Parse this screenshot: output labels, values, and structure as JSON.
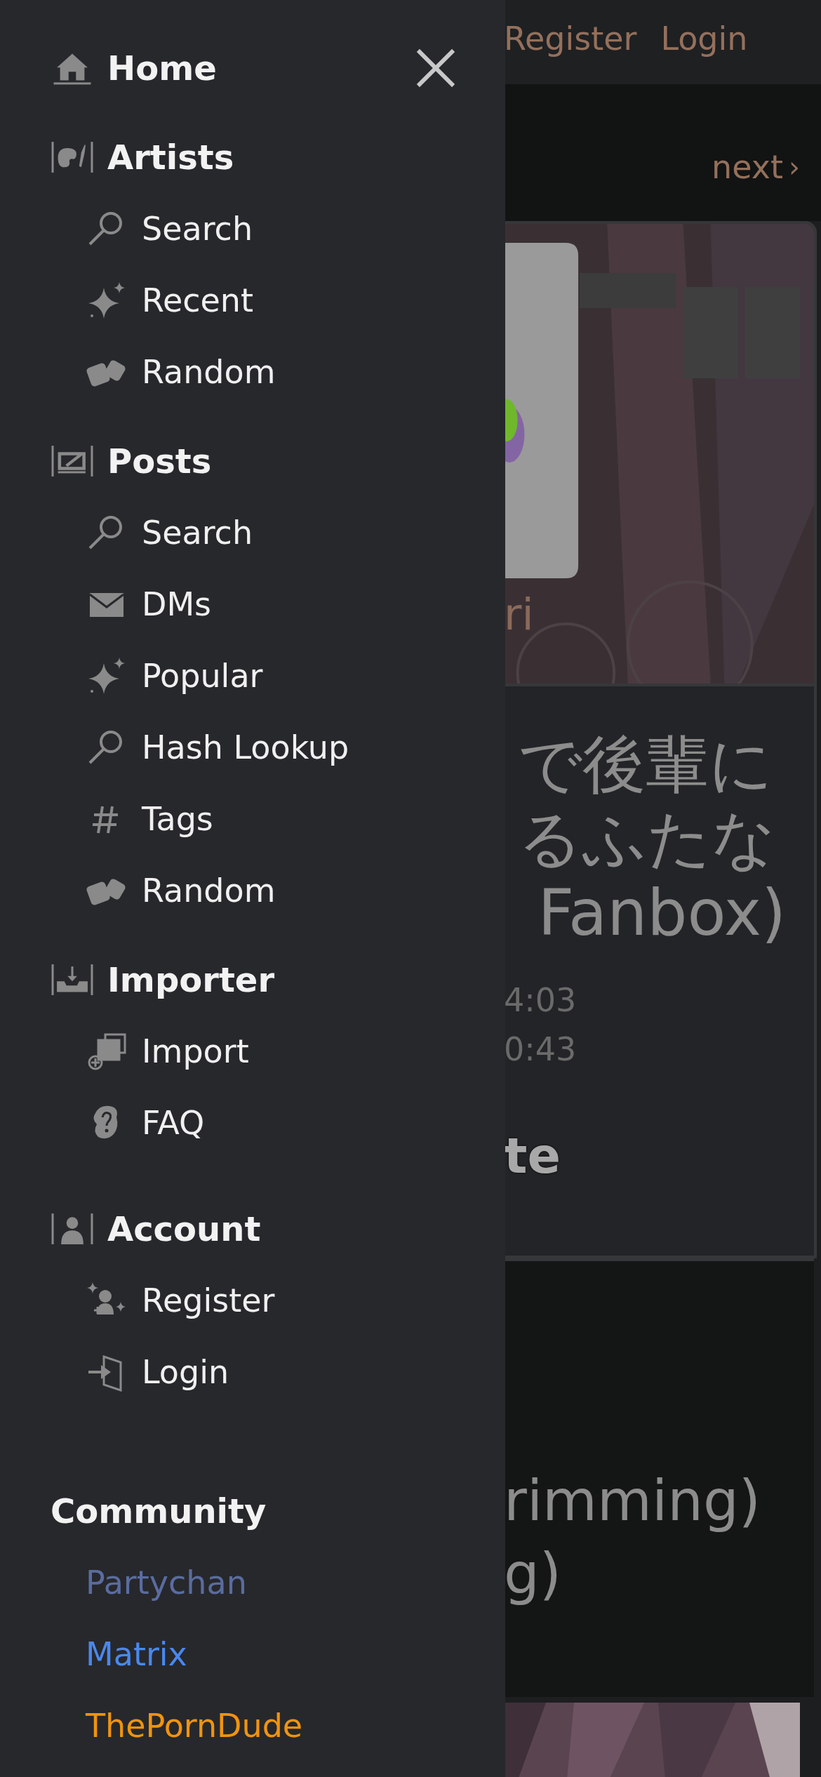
{
  "drawer": {
    "sections": [
      {
        "kind": "home",
        "title": "Home"
      },
      {
        "kind": "artists",
        "title": "Artists",
        "items": [
          {
            "kind": "search",
            "label": "Search"
          },
          {
            "kind": "sparkle",
            "label": "Recent"
          },
          {
            "kind": "dice",
            "label": "Random"
          }
        ]
      },
      {
        "kind": "posts",
        "title": "Posts",
        "items": [
          {
            "kind": "search",
            "label": "Search"
          },
          {
            "kind": "mail",
            "label": "DMs"
          },
          {
            "kind": "sparkle",
            "label": "Popular"
          },
          {
            "kind": "search",
            "label": "Hash Lookup"
          },
          {
            "kind": "hash",
            "label": "Tags"
          },
          {
            "kind": "dice",
            "label": "Random"
          }
        ]
      },
      {
        "kind": "importer",
        "title": "Importer",
        "items": [
          {
            "kind": "import",
            "label": "Import"
          },
          {
            "kind": "faq",
            "label": "FAQ"
          }
        ]
      },
      {
        "kind": "account",
        "title": "Account",
        "items": [
          {
            "kind": "register",
            "label": "Register"
          },
          {
            "kind": "login",
            "label": "Login"
          }
        ]
      }
    ],
    "community": {
      "title": "Community",
      "links": [
        {
          "label": "Partychan",
          "color": "#5a6ca0"
        },
        {
          "label": "Matrix",
          "color": "#4a88ee"
        },
        {
          "label": "ThePornDude",
          "color": "#f0940f"
        }
      ]
    }
  },
  "page": {
    "header_links": [
      "Register",
      "Login"
    ],
    "pager": {
      "next": "next",
      "arrow": "›"
    },
    "post": {
      "image_caption": "ri",
      "title_lines": [
        "で後輩に",
        "るふたな",
        " Fanbox)"
      ],
      "times": [
        "4:03",
        "0:43"
      ],
      "heading": "te"
    },
    "files": {
      "lines": [
        "rimming)",
        "g)"
      ]
    }
  }
}
